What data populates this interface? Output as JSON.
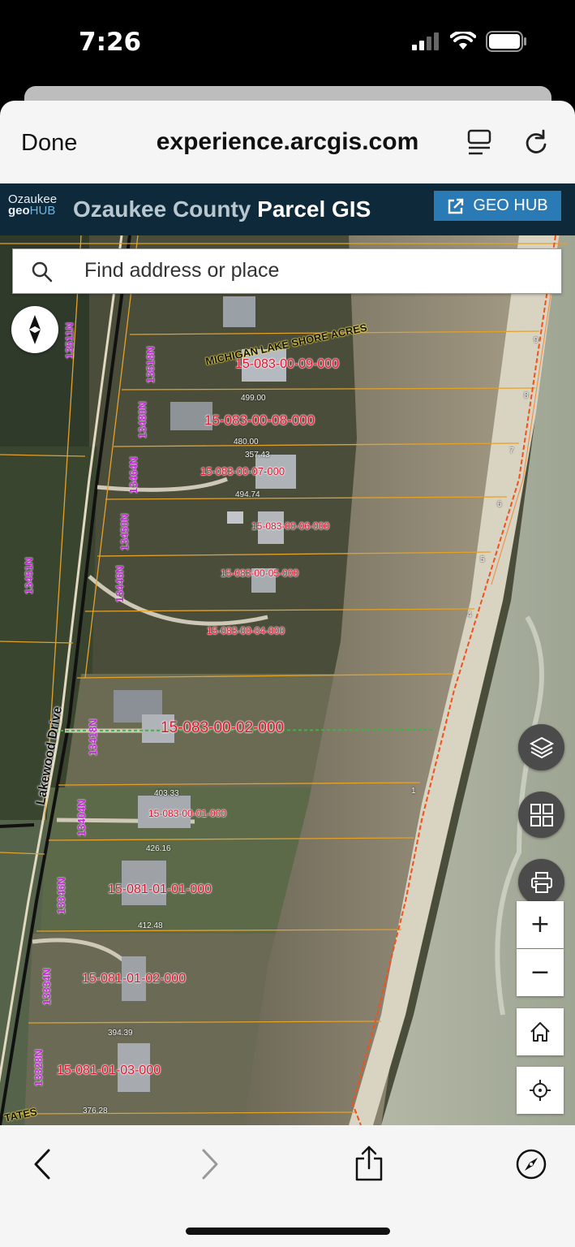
{
  "status_bar": {
    "time": "7:26"
  },
  "browser": {
    "done_label": "Done",
    "url": "experience.arcgis.com"
  },
  "app": {
    "logo_top": "Ozaukee",
    "logo_bottom_geo": "geo",
    "logo_bottom_hub": "HUB",
    "title_muted": "Ozaukee County",
    "title_bold": "Parcel GIS",
    "geohub_label": "GEO HUB"
  },
  "search": {
    "placeholder": "Find address or place"
  },
  "map": {
    "zoom_in_label": "+",
    "zoom_out_label": "−",
    "road_name": "Lakewood Drive",
    "subdivision": "MICHIGAN LAKE SHORE ACRES",
    "subdivision_bottom": "TATES",
    "parcels": [
      "15-083-00-09-000",
      "15-083-00-08-000",
      "15-083-00-07-000",
      "15-083-00-06-000",
      "15-083-00-05-000",
      "15-083-00-04-000",
      "15-083-00-02-000",
      "15-083-00-01-000",
      "15-081-01-01-000",
      "15-081-01-02-000",
      "15-081-01-03-000"
    ],
    "addresses": [
      "13511N",
      "13518N",
      "13480N",
      "13464N",
      "13450N",
      "13446N",
      "13451N",
      "13418N",
      "13404N",
      "13346N",
      "13334N",
      "13328N"
    ],
    "dimensions": [
      "499.00",
      "480.00",
      "357.43",
      "494.74",
      "403.33",
      "426.16",
      "412.48",
      "394.39",
      "376.28"
    ],
    "lot_numbers": [
      "9",
      "8",
      "7",
      "6",
      "5",
      "4",
      "1"
    ]
  }
}
